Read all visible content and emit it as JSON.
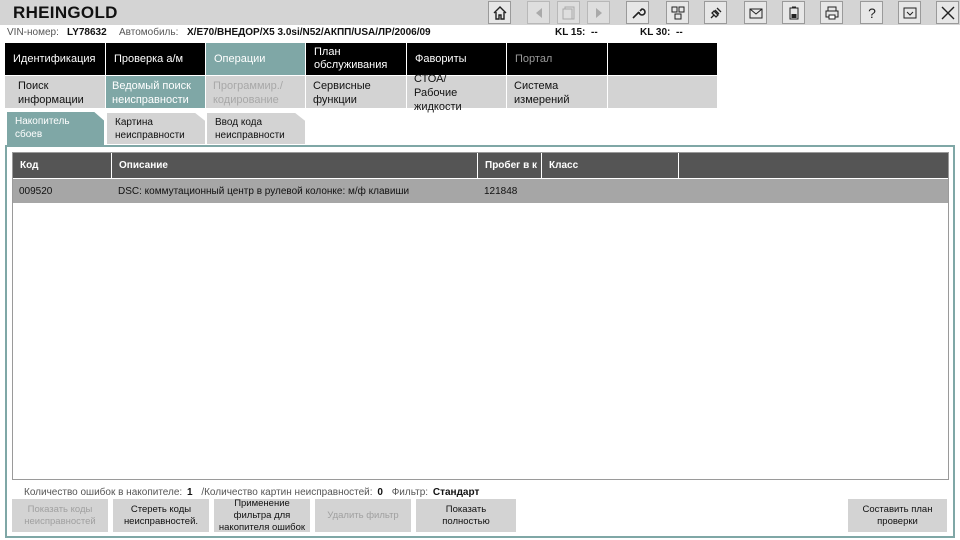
{
  "app": {
    "title": "RHEINGOLD"
  },
  "info": {
    "vin_label": "VIN-номер:",
    "vin_value": "LY78632",
    "car_label": "Автомобиль:",
    "car_value": "X/E70/ВНЕДОР/X5 3.0si/N52/АКПП/USA/ЛР/2006/09",
    "kl15_label": "KL 15:",
    "kl15_value": "--",
    "kl30_label": "KL 30:",
    "kl30_value": "--"
  },
  "main_tabs": [
    {
      "line1": "Идентификация",
      "line2": ""
    },
    {
      "line1": "Проверка а/м",
      "line2": ""
    },
    {
      "line1": "Операции",
      "line2": ""
    },
    {
      "line1": "План",
      "line2": "обслуживания"
    },
    {
      "line1": "Фавориты",
      "line2": ""
    },
    {
      "line1": "Портал",
      "line2": ""
    }
  ],
  "sub_tabs": [
    {
      "line1": "Поиск",
      "line2": "информации"
    },
    {
      "line1": "Ведомый поиск",
      "line2": "неисправности"
    },
    {
      "line1": "Программир./",
      "line2": "кодирование"
    },
    {
      "line1": "Сервисные",
      "line2": "функции"
    },
    {
      "line1": "СТОА/",
      "line2": "Рабочие жидкости"
    },
    {
      "line1": "Система",
      "line2": "измерений"
    }
  ],
  "content_tabs": [
    {
      "line1": "Накопитель",
      "line2": "сбоев"
    },
    {
      "line1": "Картина",
      "line2": "неисправности"
    },
    {
      "line1": "Ввод кода",
      "line2": "неисправности"
    }
  ],
  "grid": {
    "columns": [
      "Код",
      "Описание",
      "Пробег в к",
      "Класс",
      ""
    ],
    "rows": [
      {
        "code": "009520",
        "description": "DSC: коммутационный центр в рулевой колонке: м/ф клавиши",
        "mileage": "121848",
        "class": "",
        "extra": ""
      }
    ]
  },
  "status": {
    "faults_label": "Количество ошибок в накопителе:",
    "faults_value": "1",
    "images_label": "/Количество картин неисправностей:",
    "images_value": "0",
    "filter_label": "Фильтр:",
    "filter_value": "Стандарт"
  },
  "buttons": {
    "show_codes": {
      "line1": "Показать коды",
      "line2": "неисправностей"
    },
    "clear_codes": {
      "line1": "Стереть коды",
      "line2": "неисправностей."
    },
    "apply_filter": {
      "line1": "Применение",
      "line2": "фильтра для",
      "line3": "накопителя ошибок"
    },
    "remove_filter": "Удалить фильтр",
    "show_all": {
      "line1": "Показать",
      "line2": "полностью"
    },
    "make_plan": {
      "line1": "Составить план",
      "line2": "проверки"
    }
  },
  "colors": {
    "accent": "#7fa7a6",
    "nav_bg": "#000000",
    "subnav_bg": "#d3d3d3",
    "header_bg": "#555555",
    "row_selected": "#a6a6a6"
  },
  "toolbar_icons": [
    "home-icon",
    "back-icon",
    "document-icon",
    "forward-icon",
    "wrench-icon",
    "connection-icon",
    "plug-icon",
    "mail-icon",
    "battery-icon",
    "printer-icon",
    "help-icon",
    "minimize-icon",
    "close-icon"
  ]
}
